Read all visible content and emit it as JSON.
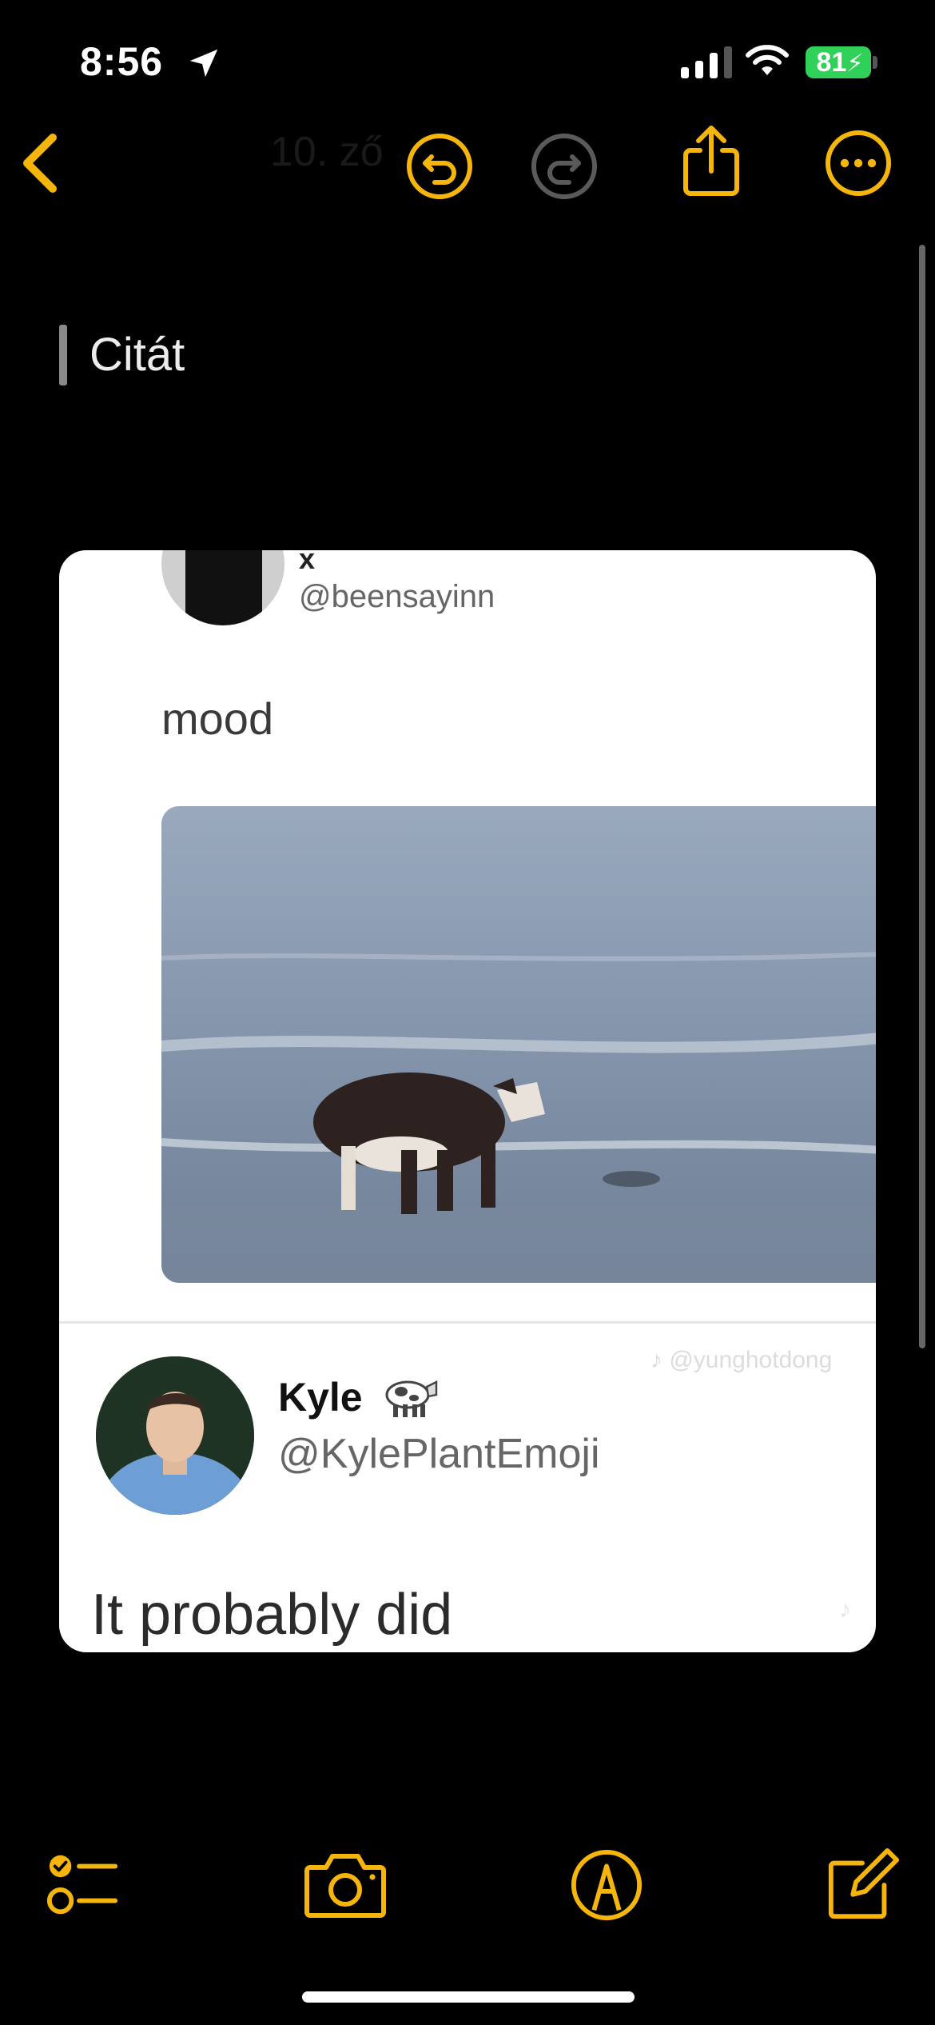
{
  "status_bar": {
    "time": "8:56",
    "battery": "81",
    "icons": [
      "location-arrow-icon",
      "cellular-signal-icon",
      "wifi-icon",
      "battery-charging-icon"
    ]
  },
  "nav": {
    "ghost_title": "10. ző",
    "icons": [
      "back-chevron-icon",
      "undo-icon",
      "redo-icon",
      "share-icon",
      "more-icon"
    ],
    "accent_color": "#f5b50c"
  },
  "note": {
    "quote_text": "Citát"
  },
  "embedded_image": {
    "tweet1": {
      "name": "x",
      "handle": "@beensayinn",
      "text": "mood"
    },
    "watermark": "♪ @yunghotdong",
    "tweet2": {
      "name": "Kyle",
      "handle": "@KylePlantEmoji",
      "text": "It probably did"
    },
    "watermark2": "♪"
  },
  "toolbar": {
    "icons": [
      "checklist-icon",
      "camera-icon",
      "markup-icon",
      "compose-icon"
    ]
  }
}
